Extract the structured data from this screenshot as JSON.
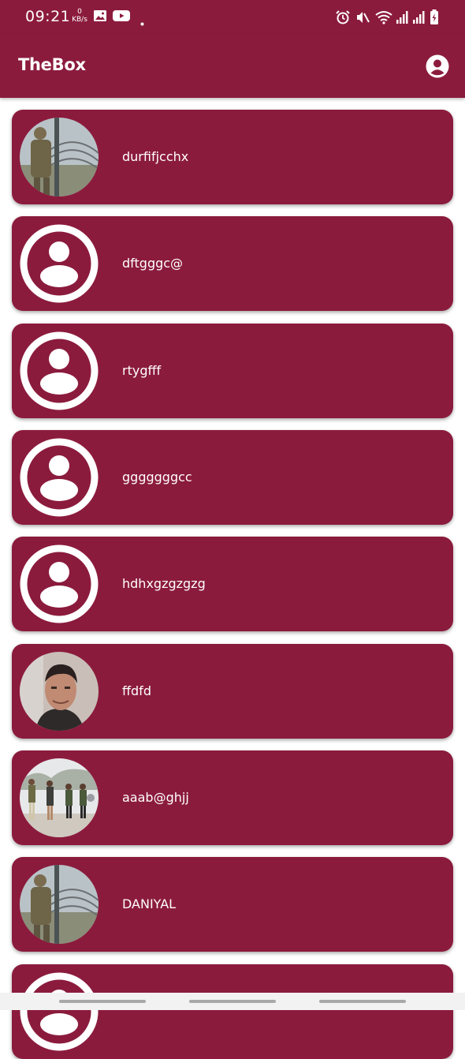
{
  "status_bar": {
    "time": "09:21",
    "speed_value": "0",
    "speed_unit": "KB/s",
    "icons": [
      "gallery-icon",
      "youtube-icon",
      "dot-icon",
      "alarm-icon",
      "mute-icon",
      "wifi-icon",
      "signal-icon",
      "signal-icon",
      "battery-charging-icon"
    ]
  },
  "app_bar": {
    "title": "TheBox",
    "account_icon": "account-circle-icon"
  },
  "colors": {
    "primary": "#8b1b3d",
    "on_primary": "#ffffff"
  },
  "users": [
    {
      "name": "durfifjcchx",
      "avatar": "photo-soldier"
    },
    {
      "name": "dftgggc@",
      "avatar": "default-person-icon"
    },
    {
      "name": "rtygfff",
      "avatar": "default-person-icon"
    },
    {
      "name": "gggggggcc",
      "avatar": "default-person-icon"
    },
    {
      "name": "hdhxgzgzgzg",
      "avatar": "default-person-icon"
    },
    {
      "name": "ffdfd",
      "avatar": "photo-selfie"
    },
    {
      "name": "aaab@ghjj",
      "avatar": "photo-group"
    },
    {
      "name": "DANIYAL",
      "avatar": "photo-soldier"
    },
    {
      "name": "",
      "avatar": "default-person-icon"
    }
  ]
}
